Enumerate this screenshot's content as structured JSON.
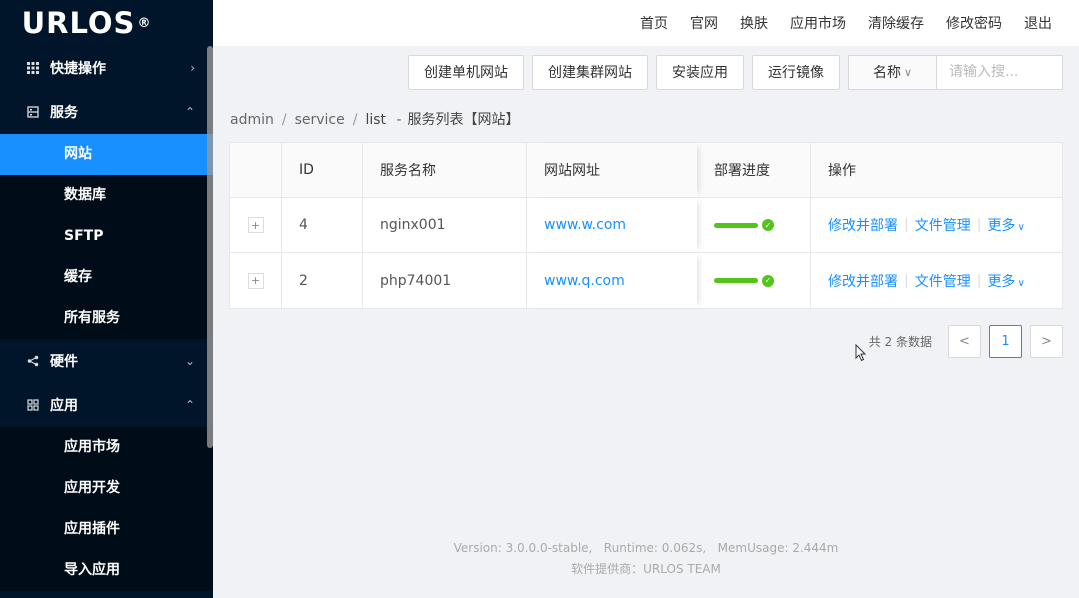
{
  "logo": {
    "text": "URLOS",
    "mark": "®"
  },
  "sidebar": {
    "groups": [
      {
        "label": "快捷操作",
        "icon": "grid-icon",
        "arrow": "›"
      },
      {
        "label": "服务",
        "icon": "server-icon",
        "arrow": "⌃",
        "items": [
          "网站",
          "数据库",
          "SFTP",
          "缓存",
          "所有服务"
        ],
        "active": "网站"
      },
      {
        "label": "硬件",
        "icon": "share-icon",
        "arrow": "⌄"
      },
      {
        "label": "应用",
        "icon": "apps-icon",
        "arrow": "⌃",
        "items": [
          "应用市场",
          "应用开发",
          "应用插件",
          "导入应用"
        ]
      }
    ]
  },
  "topnav": [
    "首页",
    "官网",
    "换肤",
    "应用市场",
    "清除缓存",
    "修改密码",
    "退出"
  ],
  "toolbar": {
    "buttons": [
      "创建单机网站",
      "创建集群网站",
      "安装应用",
      "运行镜像"
    ],
    "search_select": "名称",
    "search_placeholder": "请输入搜..."
  },
  "breadcrumb": {
    "parts": [
      "admin",
      "service",
      "list"
    ],
    "dash": "-",
    "title": "服务列表【网站】"
  },
  "table": {
    "headers": [
      "ID",
      "服务名称",
      "网站网址",
      "部署进度",
      "操作"
    ],
    "rows": [
      {
        "id": "4",
        "name": "nginx001",
        "url": "www.w.com",
        "progress": 1.0
      },
      {
        "id": "2",
        "name": "php74001",
        "url": "www.q.com",
        "progress": 1.0
      }
    ],
    "ops": [
      "修改并部署",
      "文件管理",
      "更多"
    ]
  },
  "pagination": {
    "total": "共 2 条数据",
    "current": "1",
    "prev": "<",
    "next": ">"
  },
  "footer": {
    "line1": "Version: 3.0.0.0-stable,   Runtime: 0.062s,   MemUsage: 2.444m",
    "line2": "软件提供商：URLOS TEAM"
  },
  "colors": {
    "sidebar": "#001529",
    "accent": "#1890ff",
    "success": "#52c41a"
  }
}
